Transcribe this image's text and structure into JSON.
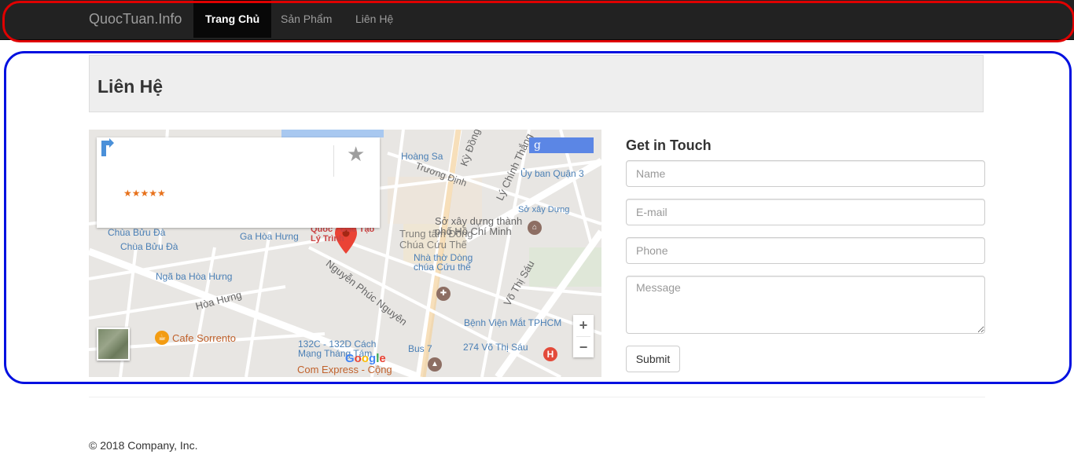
{
  "navbar": {
    "brand": "QuocTuan.Info",
    "items": [
      {
        "label": "Trang Chủ",
        "active": true
      },
      {
        "label": "Sản Phẩm",
        "active": false
      },
      {
        "label": "Liên Hệ",
        "active": false
      }
    ],
    "background_color": "#222222"
  },
  "page": {
    "title": "Liên Hệ"
  },
  "map": {
    "info_card": {
      "rating_stars": "★★★★★",
      "directions_icon": "directions-icon",
      "save_icon": "star-icon"
    },
    "google_badge": "g",
    "zoom_in": "+",
    "zoom_out": "−",
    "google_logo": [
      "G",
      "o",
      "o",
      "g",
      "l",
      "e"
    ],
    "cafe_icon": "☕",
    "hospital_icon": "H",
    "labels": [
      {
        "text": "Hoàng Sa",
        "style": "blue"
      },
      {
        "text": "Trương Định",
        "style": "dark"
      },
      {
        "text": "Ủy ban Quận 3",
        "style": "blue"
      },
      {
        "text": "Sở xây Dựng",
        "style": "blue"
      },
      {
        "text": "Sở xây dựng thành phố Hồ Chí Minh",
        "style": "dark"
      },
      {
        "text": "Trung tâm Đồng Chúa Cứu Thế",
        "style": "dark"
      },
      {
        "text": "Nhà thờ Dòng chúa Cứu thế",
        "style": "blue"
      },
      {
        "text": "Chùa Bửu Đà",
        "style": "blue"
      },
      {
        "text": "Ga Hòa Hưng",
        "style": "blue"
      },
      {
        "text": "Ngã ba Hòa Hưng",
        "style": "blue"
      },
      {
        "text": "Hòa Hưng",
        "style": "dark"
      },
      {
        "text": "Nguyễn Phúc Nguyên",
        "style": "dark"
      },
      {
        "text": "Võ Thị Sáu",
        "style": "dark"
      },
      {
        "text": "Bệnh Viện Mắt TPHCM",
        "style": "blue"
      },
      {
        "text": "Cafe Sorrento",
        "style": "orange"
      },
      {
        "text": "132C - 132D Cách Mạng Tháng Tám",
        "style": "blue"
      },
      {
        "text": "Bus 7",
        "style": "blue"
      },
      {
        "text": "274 Võ Thị Sáu",
        "style": "blue"
      },
      {
        "text": "Com Express - Cộng",
        "style": "orange"
      },
      {
        "text": "Quốc - Đào Tạo Lý Trình",
        "style": "red"
      },
      {
        "text": "Lý Chính Thắng",
        "style": "dark"
      },
      {
        "text": "Kỳ Đồng",
        "style": "dark"
      }
    ]
  },
  "contact_form": {
    "title": "Get in Touch",
    "name_placeholder": "Name",
    "email_placeholder": "E-mail",
    "phone_placeholder": "Phone",
    "message_placeholder": "Message",
    "submit_label": "Submit"
  },
  "footer": {
    "text": "© 2018 Company, Inc."
  },
  "colors": {
    "annotation_red": "#e00000",
    "annotation_blue": "#0010e0",
    "header_bg": "#eeeeee",
    "map_pin": "#ea4335"
  }
}
